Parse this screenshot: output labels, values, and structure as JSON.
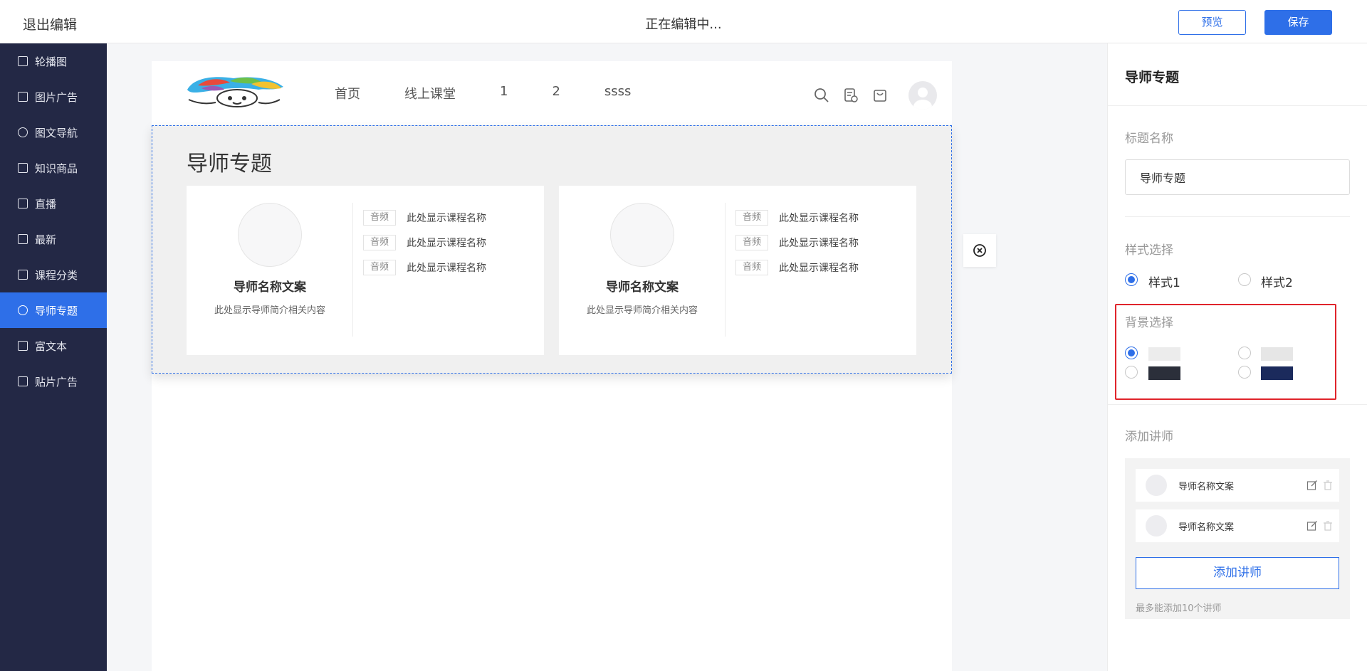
{
  "topbar": {
    "exit_label": "退出编辑",
    "status": "正在编辑中...",
    "preview_label": "预览",
    "save_label": "保存"
  },
  "sidebar": {
    "items": [
      {
        "label": "轮播图",
        "icon": "monitor-icon"
      },
      {
        "label": "图片广告",
        "icon": "image-icon"
      },
      {
        "label": "图文导航",
        "icon": "bulb-icon"
      },
      {
        "label": "知识商品",
        "icon": "books-icon"
      },
      {
        "label": "直播",
        "icon": "live-icon"
      },
      {
        "label": "最新",
        "icon": "card-icon"
      },
      {
        "label": "课程分类",
        "icon": "grid-icon"
      },
      {
        "label": "导师专题",
        "icon": "user-icon",
        "active": true
      },
      {
        "label": "富文本",
        "icon": "document-icon"
      },
      {
        "label": "贴片广告",
        "icon": "sticker-icon"
      }
    ]
  },
  "site_header": {
    "nav": [
      "首页",
      "线上课堂",
      "1",
      "2",
      "ssss"
    ]
  },
  "module": {
    "title": "导师专题",
    "cards": [
      {
        "teacher_name": "导师名称文案",
        "teacher_intro": "此处显示导师简介相关内容",
        "courses": [
          {
            "tag": "音频",
            "name": "此处显示课程名称"
          },
          {
            "tag": "音频",
            "name": "此处显示课程名称"
          },
          {
            "tag": "音频",
            "name": "此处显示课程名称"
          }
        ]
      },
      {
        "teacher_name": "导师名称文案",
        "teacher_intro": "此处显示导师简介相关内容",
        "courses": [
          {
            "tag": "音频",
            "name": "此处显示课程名称"
          },
          {
            "tag": "音频",
            "name": "此处显示课程名称"
          },
          {
            "tag": "音频",
            "name": "此处显示课程名称"
          }
        ]
      }
    ]
  },
  "panel": {
    "title": "导师专题",
    "title_field_label": "标题名称",
    "title_field_value": "导师专题",
    "style_label": "样式选择",
    "style_options": [
      "样式1",
      "样式2"
    ],
    "style_selected": "样式1",
    "bg_label": "背景选择",
    "bg_options": [
      {
        "color": "#ececec",
        "selected": true
      },
      {
        "color": "#e6e6e6",
        "selected": false
      },
      {
        "color": "#2b2f3a",
        "selected": false
      },
      {
        "color": "#1b2a5c",
        "selected": false
      }
    ],
    "teachers_label": "添加讲师",
    "teachers": [
      {
        "name": "导师名称文案"
      },
      {
        "name": "导师名称文案"
      }
    ],
    "add_teacher_label": "添加讲师",
    "limit_hint": "最多能添加10个讲师"
  },
  "colors": {
    "accent": "#2e6fe8",
    "sidebar_bg": "#232845",
    "highlight": "#e0242b"
  }
}
